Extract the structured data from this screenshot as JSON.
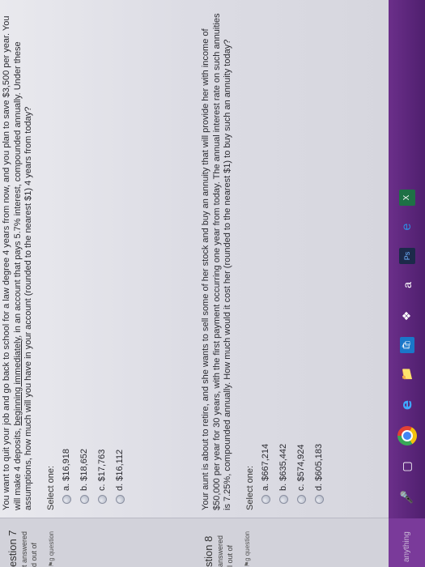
{
  "q7": {
    "label": "estion 7",
    "status": "t answered",
    "marks": "d out of",
    "flag": "g question",
    "text_before": "You want to quit your job and go back to school for a law degree 4 years from now, and you plan to save $3,500 per year. You will make 4 deposits, ",
    "text_underlined": "beginning immediately",
    "text_after": ", in an account that pays 5.7% interest, compounded annually. Under these assumptions, how much will you have in your account (rounded to the nearest $1) 4 years from today?",
    "select_label": "Select one:",
    "options": [
      "a. $16,918",
      "b. $18,652",
      "c. $17,763",
      "d. $16,112"
    ]
  },
  "q8": {
    "label": "stion 8",
    "status": "answered",
    "marks": "l out of",
    "flag": "g question",
    "text": "Your aunt is about to retire, and she wants to sell some of her stock and buy an annuity that will provide her with income of $50,000 per year for 30 years, with the first payment occurring one year from today. The annual interest rate on such annuities is 7.25%, compounded annually. How much would it cost her (rounded to the nearest $1) to buy such an annuity today?",
    "select_label": "Select one:",
    "options": [
      "a. $667,214",
      "b. $635,442",
      "c. $574,924",
      "d. $605,183"
    ]
  },
  "taskbar": {
    "search_placeholder": "anything",
    "icons": [
      "microphone-icon",
      "task-view-icon",
      "chrome-icon",
      "edge-icon",
      "file-explorer-icon",
      "store-icon",
      "dropbox-icon",
      "amazon-icon",
      "photoshop-icon",
      "ie-icon",
      "excel-icon"
    ]
  }
}
